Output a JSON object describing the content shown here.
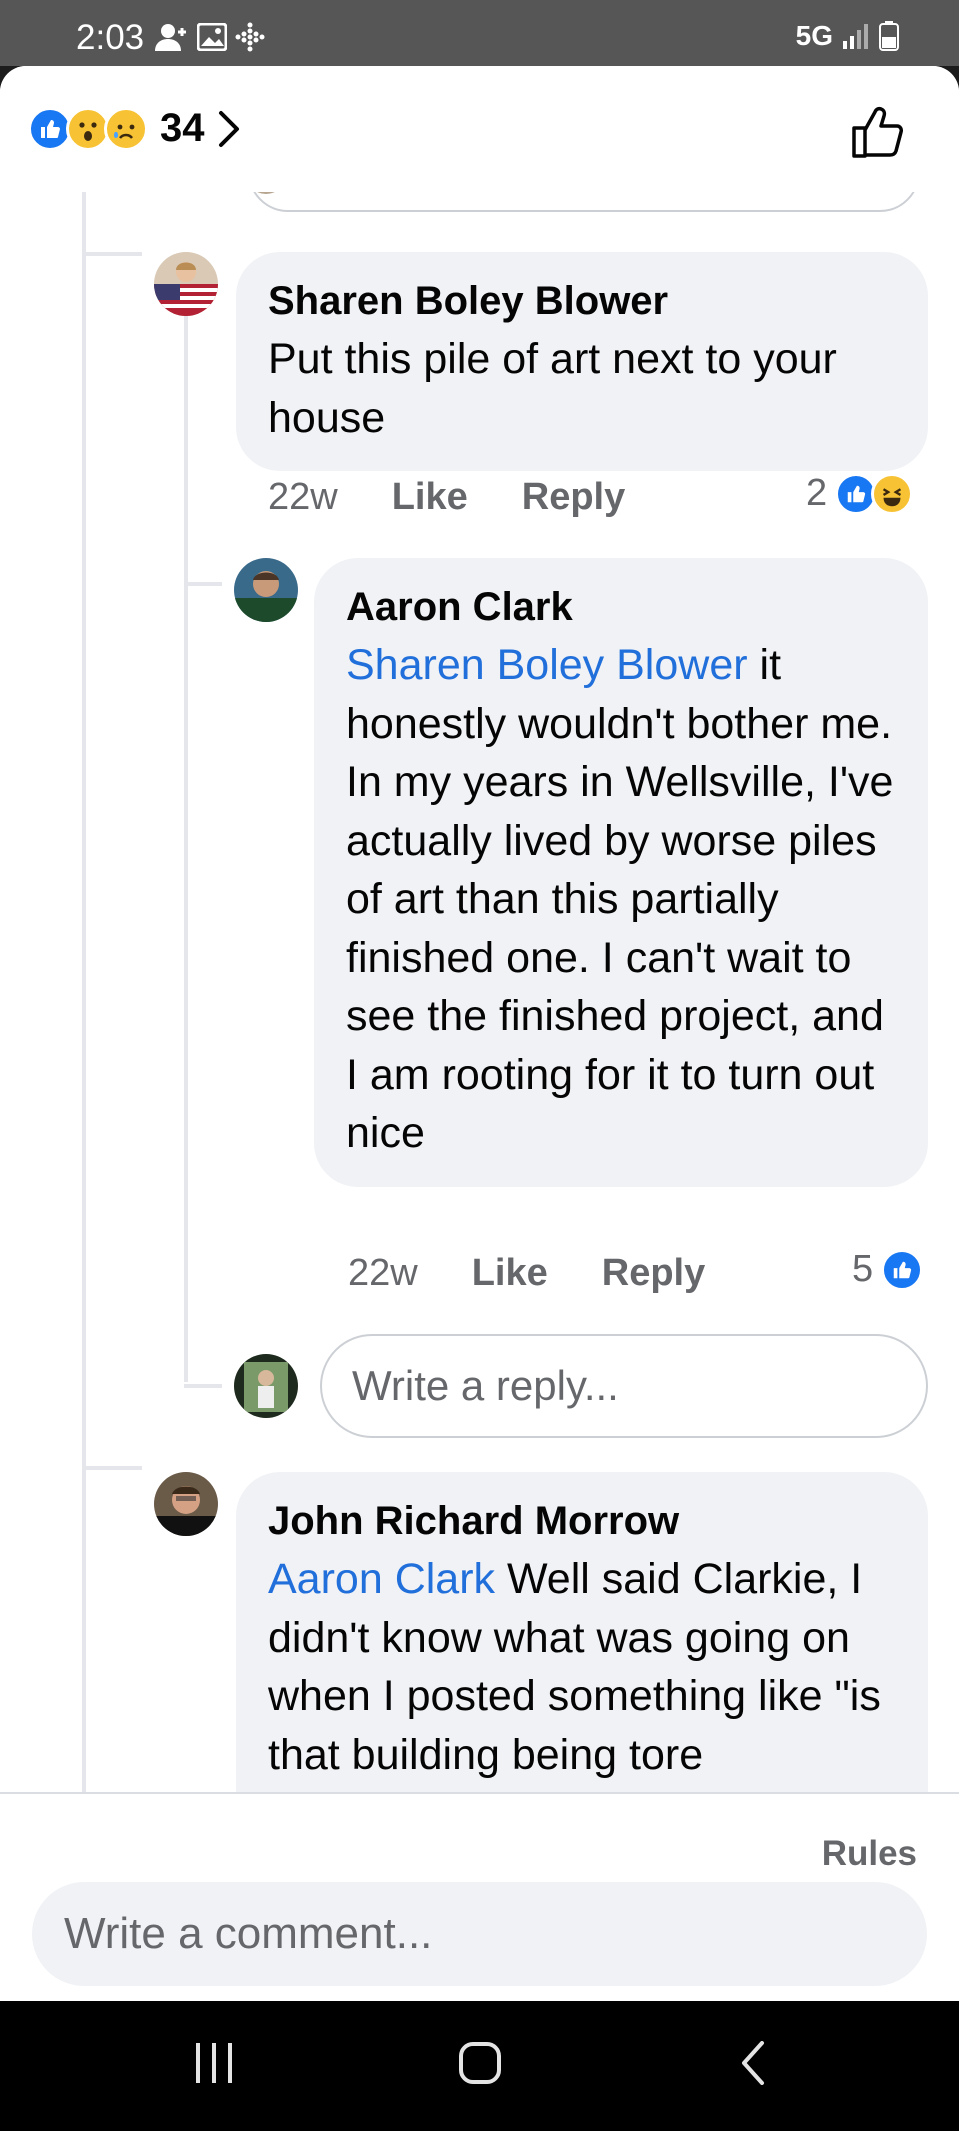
{
  "status_bar": {
    "time": "2:03",
    "network": "5G"
  },
  "header": {
    "reaction_count": "34"
  },
  "comments": [
    {
      "author": "Sharen Boley Blower",
      "mention": "",
      "text": "Put this pile of art next to your house",
      "time": "22w",
      "like_label": "Like",
      "reply_label": "Reply",
      "reaction_count": "2"
    },
    {
      "author": "Aaron Clark",
      "mention": "Sharen Boley Blower",
      "text": " it honestly wouldn't bother me. In my years in Wellsville, I've actually lived by worse piles of art than this partially finished one. I can't wait to see the finished project, and I am rooting for it to turn out nice",
      "time": "22w",
      "like_label": "Like",
      "reply_label": "Reply",
      "reaction_count": "5"
    },
    {
      "author": "John Richard Morrow",
      "mention": "Aaron Clark",
      "text": " Well said Clarkie, I didn't know what was going on when I posted something like \"is that building being tore"
    }
  ],
  "reply_input": {
    "placeholder": "Write a reply..."
  },
  "footer": {
    "rules_label": "Rules",
    "comment_placeholder": "Write a comment..."
  },
  "colors": {
    "accent": "#1877f2",
    "mention": "#216fdb",
    "bubble": "#f0f2f5",
    "muted": "#65676b"
  }
}
